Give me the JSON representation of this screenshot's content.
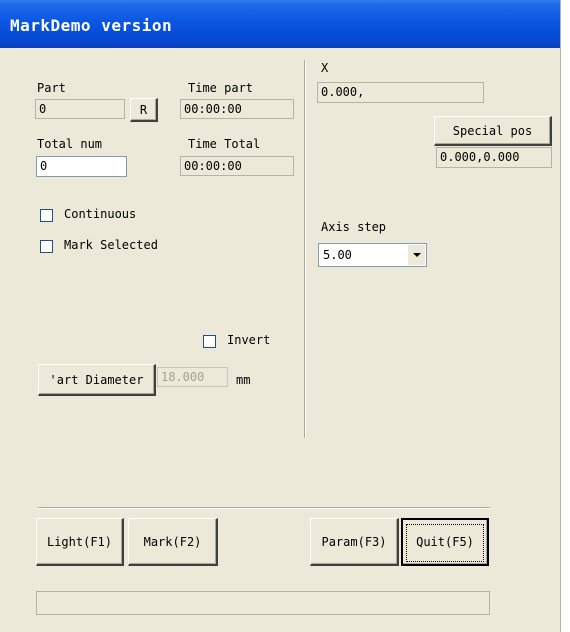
{
  "window": {
    "title": "MarkDemo version"
  },
  "left_panel": {
    "part_label": "Part",
    "part_value": "0",
    "reset_button": "R",
    "time_part_label": "Time part",
    "time_part_value": "00:00:00",
    "total_num_label": "Total num",
    "total_num_value": "0",
    "time_total_label": "Time Total",
    "time_total_value": "00:00:00",
    "continuous_label": "Continuous",
    "continuous_checked": false,
    "mark_selected_label": "Mark Selected",
    "mark_selected_checked": false,
    "invert_label": "Invert",
    "invert_checked": false,
    "part_diameter_button": "'art Diameter",
    "part_diameter_value": "18.000",
    "part_diameter_unit": "mm"
  },
  "right_panel": {
    "x_label": "X",
    "x_value": "0.000,",
    "special_pos_button": "Special pos",
    "special_pos_value": "0.000,0.000",
    "axis_step_label": "Axis step",
    "axis_step_value": "5.00"
  },
  "bottom_buttons": {
    "light": "Light(F1)",
    "mark": "Mark(F2)",
    "param": "Param(F3)",
    "quit": "Quit(F5)"
  },
  "status_bar": {
    "text": ""
  }
}
